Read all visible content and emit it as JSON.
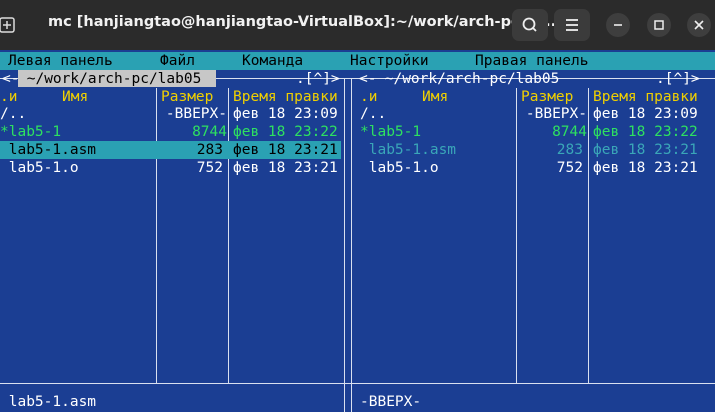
{
  "window": {
    "title": "mc [hanjiangtao@hanjiangtao-VirtualBox]:~/work/arch-pc/la...",
    "icons": [
      "new-tab-icon",
      "search-icon",
      "hamburger-menu-icon",
      "minimize-icon",
      "maximize-icon",
      "close-icon"
    ]
  },
  "menu": {
    "left_panel": "Левая панель",
    "file": "Файл",
    "command": "Команда",
    "settings": "Настройки",
    "right_panel": "Правая панель"
  },
  "left_panel": {
    "path_prefix": "<-",
    "path": " ~/work/arch-pc/lab05 ",
    "path_suffix": ".[^]>",
    "headers": {
      "sort": ".и",
      "name": "Имя",
      "size": "Размер",
      "time": "Время правки"
    },
    "rows": [
      {
        "name": "/..",
        "size": "-ВВЕРХ-",
        "time": "фев 18 23:09"
      },
      {
        "name": "*lab5-1",
        "size": "8744",
        "time": "фев 18 23:22"
      },
      {
        "name": " lab5-1.asm",
        "size": "283",
        "time": "фев 18 23:21"
      },
      {
        "name": " lab5-1.o",
        "size": "752",
        "time": "фев 18 23:21"
      }
    ],
    "status": " lab5-1.asm"
  },
  "right_panel": {
    "path_prefix": "<-",
    "path": " ~/work/arch-pc/lab05",
    "path_suffix": ".[^]>",
    "headers": {
      "sort": ".и",
      "name": "Имя",
      "size": "Размер",
      "time": "Время правки"
    },
    "rows": [
      {
        "name": "/..",
        "size": "-ВВЕРХ-",
        "time": "фев 18 23:09"
      },
      {
        "name": "*lab5-1",
        "size": "8744",
        "time": "фев 18 23:22"
      },
      {
        "name": " lab5-1.asm",
        "size": "283",
        "time": "фев 18 23:21"
      },
      {
        "name": " lab5-1.o",
        "size": "752",
        "time": "фев 18 23:21"
      }
    ],
    "status": "-ВВЕРХ-"
  },
  "colors": {
    "panel_bg": "#1b3e93",
    "menu_bg": "#2aa1b3",
    "header_yellow": "#f0d000",
    "executable_green": "#2ee060",
    "source_cyan": "#3aa6b8"
  }
}
